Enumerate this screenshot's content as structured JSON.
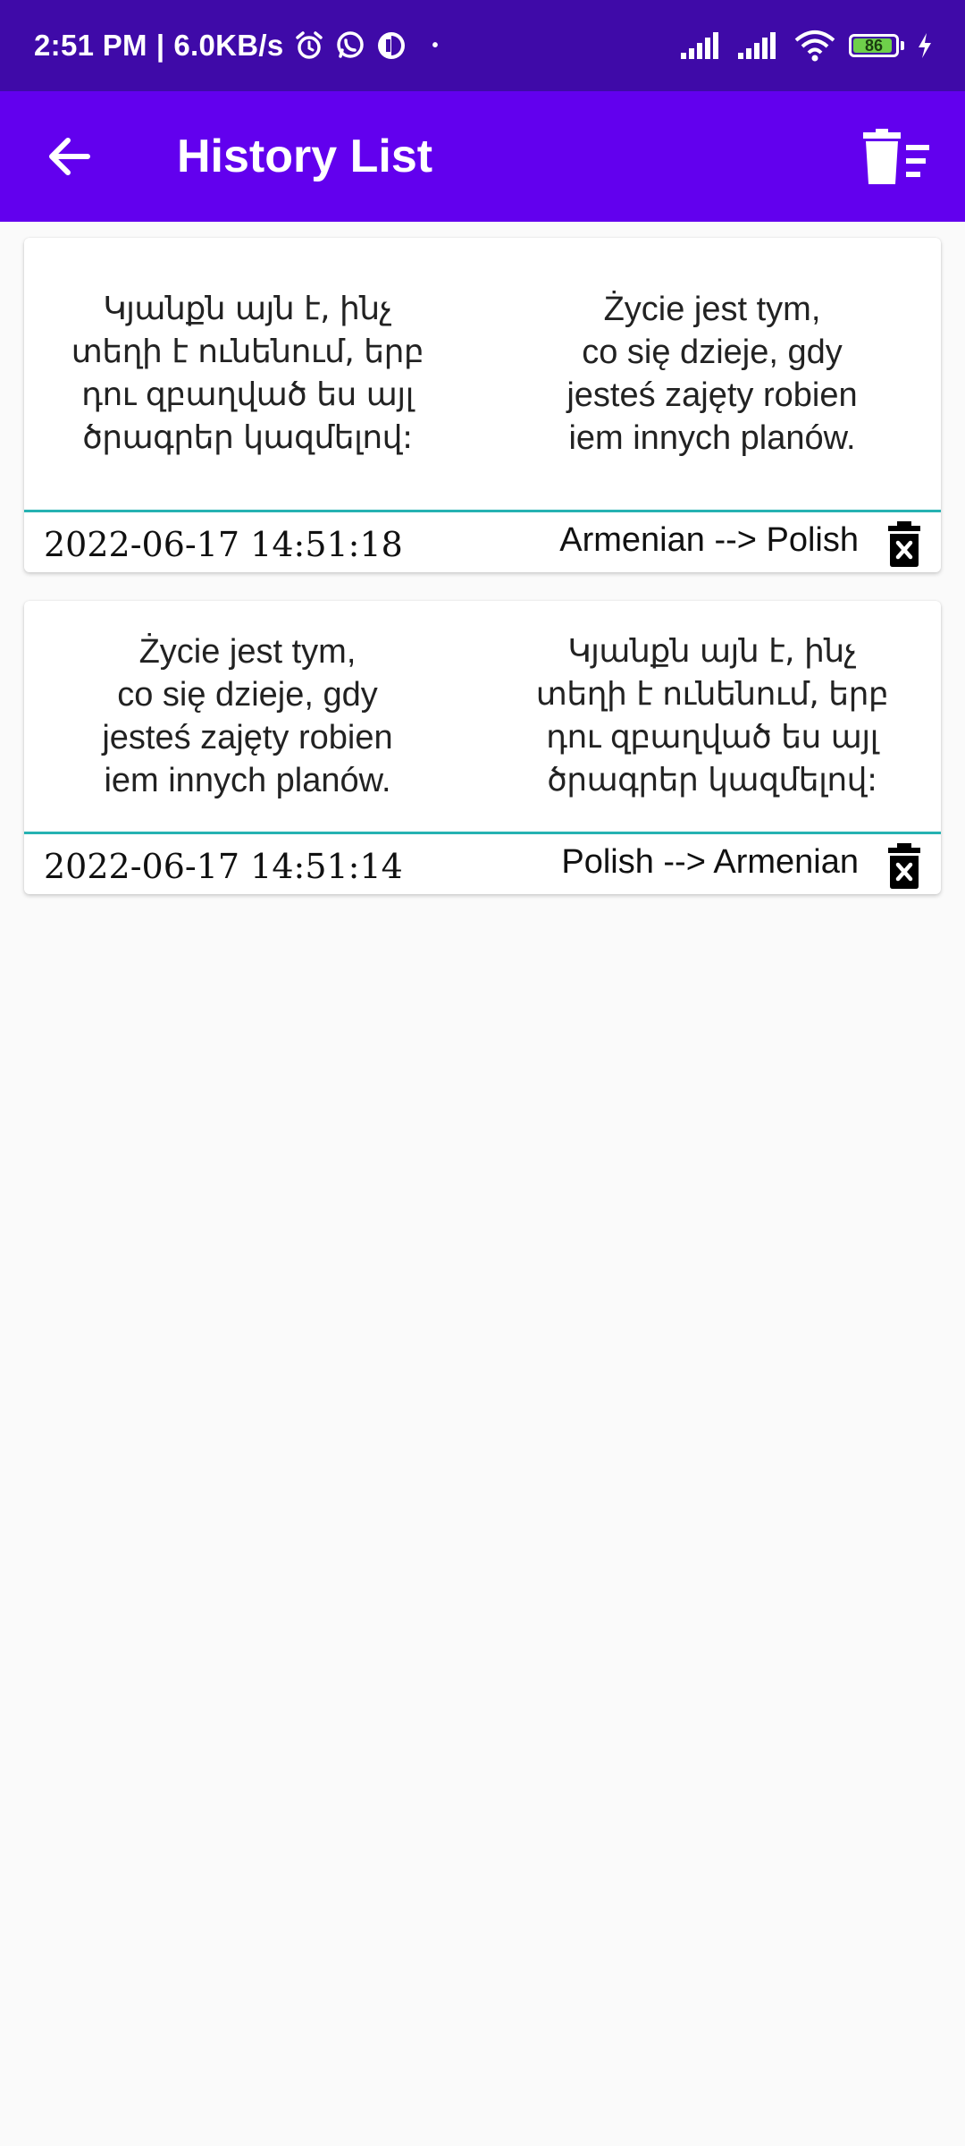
{
  "status_bar": {
    "time": "2:51 PM",
    "separator": "|",
    "net_speed": "6.0KB/s",
    "dot": "•",
    "battery": "86",
    "icons": [
      "alarm-icon",
      "whatsapp-icon",
      "app-notification-icon",
      "signal-icon",
      "signal-icon",
      "wifi-icon",
      "battery-icon",
      "charging-icon"
    ]
  },
  "app_bar": {
    "title": "History List",
    "back_icon": "arrow-back-icon",
    "clear_icon": "delete-sweep-icon",
    "color": "#6200ee"
  },
  "history": [
    {
      "source_text": "Կյանքն այն է, ինչ\nտեղի է ունենում, երբ\nդու զբաղված ես այլ\nծրագրեր կազմելով:",
      "target_text": "Życie jest tym,\nco się dzieje, gdy\njesteś zajęty robien\niem innych planów.",
      "timestamp": "2022-06-17 14:51:18",
      "direction": "Armenian --> Polish"
    },
    {
      "source_text": "Życie jest tym,\nco się dzieje, gdy\njesteś zajęty robien\niem innych planów.",
      "target_text": "Կյանքն այն է, ինչ\nտեղի է ունենում, երբ\nդու զբաղված ես այլ\nծրագրեր կազմելով:",
      "timestamp": "2022-06-17 14:51:14",
      "direction": "Polish --> Armenian"
    }
  ],
  "colors": {
    "status_bar": "#3f0aa8",
    "divider": "#26b2b2",
    "background": "#fafafa"
  }
}
